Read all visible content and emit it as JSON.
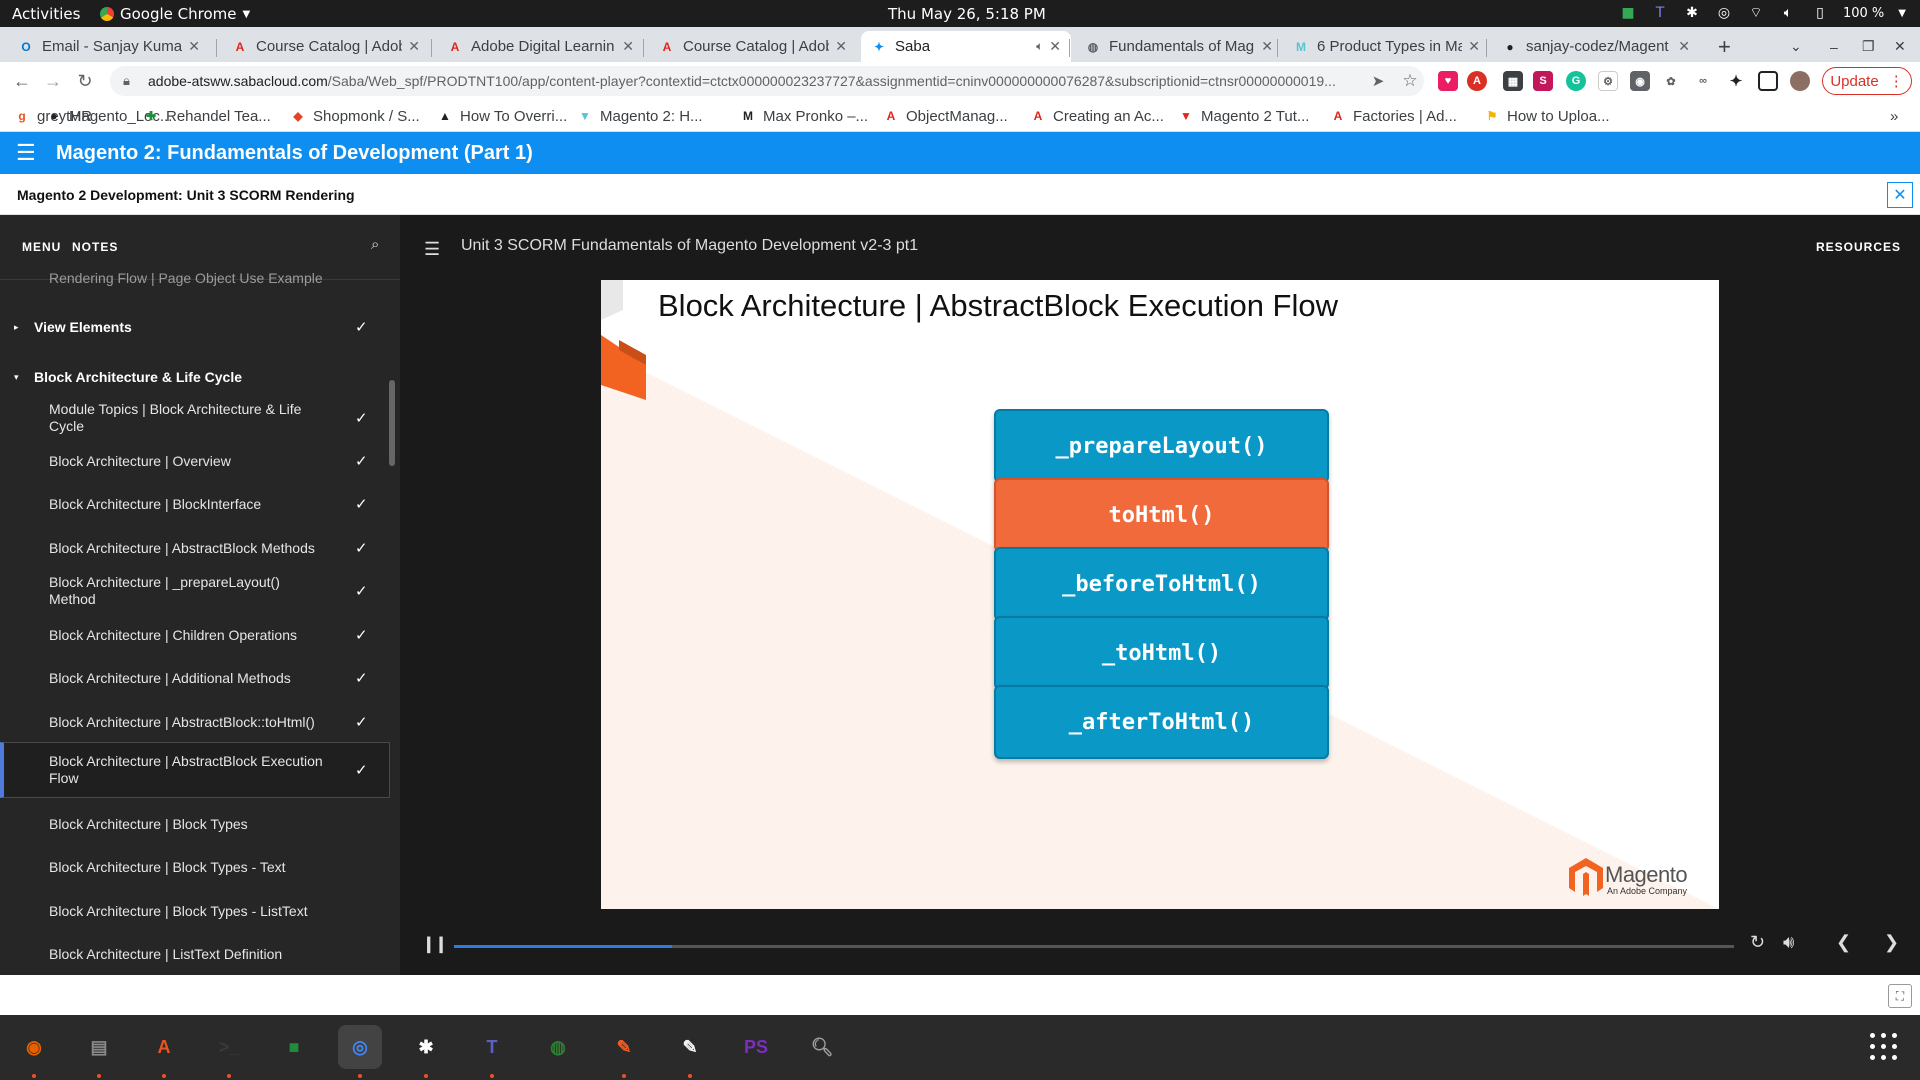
{
  "topbar": {
    "activities": "Activities",
    "app_name": "Google Chrome",
    "clock": "Thu May 26,  5:18 PM",
    "battery": "100 %"
  },
  "tabs": [
    {
      "title": "Email - Sanjay Kumar I",
      "icon": "outlook-icon",
      "color": "#0078d4"
    },
    {
      "title": "Course Catalog | Adob",
      "icon": "adobe-icon",
      "color": "#e1251b"
    },
    {
      "title": "Adobe Digital Learnin",
      "icon": "adobe-icon",
      "color": "#e1251b"
    },
    {
      "title": "Course Catalog | Adob",
      "icon": "adobe-icon",
      "color": "#e1251b"
    },
    {
      "title": "Saba",
      "icon": "saba-icon",
      "color": "#0e8ef0",
      "active": true
    },
    {
      "title": "Fundamentals of Mag",
      "icon": "globe-icon",
      "color": "#5f6368"
    },
    {
      "title": "6 Product Types in Ma",
      "icon": "magento-icon",
      "color": "#56c5d0"
    },
    {
      "title": "sanjay-codez/Magent",
      "icon": "github-icon",
      "color": "#202124"
    }
  ],
  "address": {
    "domain": "adobe-atsww.sabacloud.com",
    "path": "/Saba/Web_spf/PRODTNT100/app/content-player?contextid=ctctx000000023237727&assignmentid=cninv000000000076287&subscriptionid=ctnsr00000000019..."
  },
  "update_label": "Update",
  "bookmarks": [
    {
      "label": "greytHR",
      "icon": "greythr-icon",
      "color": "#e95420"
    },
    {
      "label": "Magento_Loc...",
      "icon": "github-icon",
      "color": "#202124"
    },
    {
      "label": "Rehandel Tea...",
      "icon": "plus-icon",
      "color": "#1e8e3e"
    },
    {
      "label": "Shopmonk / S...",
      "icon": "gitlab-icon",
      "color": "#e24329"
    },
    {
      "label": "How To Overri...",
      "icon": "mountain-icon",
      "color": "#202124"
    },
    {
      "label": "Magento 2: H...",
      "icon": "magento-icon",
      "color": "#56c5d0"
    },
    {
      "label": "Max Pronko –...",
      "icon": "mp-icon",
      "color": "#202124"
    },
    {
      "label": "ObjectManag...",
      "icon": "adobe-icon",
      "color": "#e1251b"
    },
    {
      "label": "Creating an Ac...",
      "icon": "adobe-icon",
      "color": "#e1251b"
    },
    {
      "label": "Magento 2 Tut...",
      "icon": "magento-icon",
      "color": "#e1251b"
    },
    {
      "label": "Factories | Ad...",
      "icon": "adobe-icon",
      "color": "#e1251b"
    },
    {
      "label": "How to Uploa...",
      "icon": "bookmark-icon",
      "color": "#f4b400"
    }
  ],
  "saba": {
    "course_title": "Magento 2: Fundamentals of Development (Part 1)",
    "unit_title": "Magento 2 Development: Unit 3 SCORM Rendering"
  },
  "sidebar": {
    "menu_tab": "MENU",
    "notes_tab": "NOTES",
    "items": [
      {
        "label": "Rendering Flow | Page Object Use Example",
        "type": "partial",
        "checked": false
      },
      {
        "label": "View Elements",
        "type": "section",
        "caret": "▸",
        "checked": true
      },
      {
        "label": "Block Architecture & Life Cycle",
        "type": "section",
        "caret": "▾",
        "checked": false
      },
      {
        "label": "Module Topics | Block Architecture & Life Cycle",
        "type": "item",
        "checked": true
      },
      {
        "label": "Block Architecture | Overview",
        "type": "item",
        "checked": true
      },
      {
        "label": "Block Architecture | BlockInterface",
        "type": "item",
        "checked": true
      },
      {
        "label": "Block Architecture | AbstractBlock Methods",
        "type": "item",
        "checked": true
      },
      {
        "label": "Block Architecture | _prepareLayout() Method",
        "type": "item",
        "checked": true
      },
      {
        "label": "Block Architecture | Children Operations",
        "type": "item",
        "checked": true
      },
      {
        "label": "Block Architecture | Additional Methods",
        "type": "item",
        "checked": true
      },
      {
        "label": "Block Architecture | AbstractBlock::toHtml()",
        "type": "item",
        "checked": true
      },
      {
        "label": "Block Architecture | AbstractBlock Execution Flow",
        "type": "item",
        "checked": true,
        "current": true
      },
      {
        "label": "Block Architecture | Block Types",
        "type": "item",
        "checked": false
      },
      {
        "label": "Block Architecture | Block Types - Text",
        "type": "item",
        "checked": false
      },
      {
        "label": "Block Architecture | Block Types - ListText",
        "type": "item",
        "checked": false
      },
      {
        "label": "Block Architecture | ListText Definition",
        "type": "item",
        "checked": false
      }
    ]
  },
  "player": {
    "course_label": "Unit 3 SCORM Fundamentals of Magento Development v2-3 pt1",
    "resources_label": "RESOURCES",
    "progress": 0.17
  },
  "slide": {
    "title": "Block Architecture | AbstractBlock Execution Flow",
    "steps": [
      {
        "label": "_prepareLayout()",
        "color": "blue"
      },
      {
        "label": "toHtml()",
        "color": "orange"
      },
      {
        "label": "_beforeToHtml()",
        "color": "blue"
      },
      {
        "label": "_toHtml()",
        "color": "blue"
      },
      {
        "label": "_afterToHtml()",
        "color": "blue"
      }
    ],
    "logo_word": "Magento",
    "logo_sub": "An Adobe Company"
  },
  "colors": {
    "saba_blue": "#0e8ef0",
    "step_blue": "#0a98c7",
    "step_orange": "#f06a3c",
    "magento_orange": "#f26322"
  },
  "dock": [
    {
      "name": "firefox-icon",
      "color": "#e66000"
    },
    {
      "name": "files-icon",
      "color": "#8a8a8a"
    },
    {
      "name": "software-icon",
      "color": "#e95420"
    },
    {
      "name": "terminal-icon",
      "color": "#3a3a3a"
    },
    {
      "name": "google-chat-icon",
      "color": "#1e8e3e"
    },
    {
      "name": "chrome-icon",
      "color": "#4285f4"
    },
    {
      "name": "slack-icon",
      "color": "#ffffff"
    },
    {
      "name": "teams-icon",
      "color": "#5b5fc7"
    },
    {
      "name": "camera-icon",
      "color": "#2e7d32"
    },
    {
      "name": "postman-icon",
      "color": "#ef5b25"
    },
    {
      "name": "text-editor-icon",
      "color": "#f5f5f5"
    },
    {
      "name": "phpstorm-icon",
      "color": "#7b2fbe"
    },
    {
      "name": "document-viewer-icon",
      "color": "#9e9e9e"
    }
  ]
}
